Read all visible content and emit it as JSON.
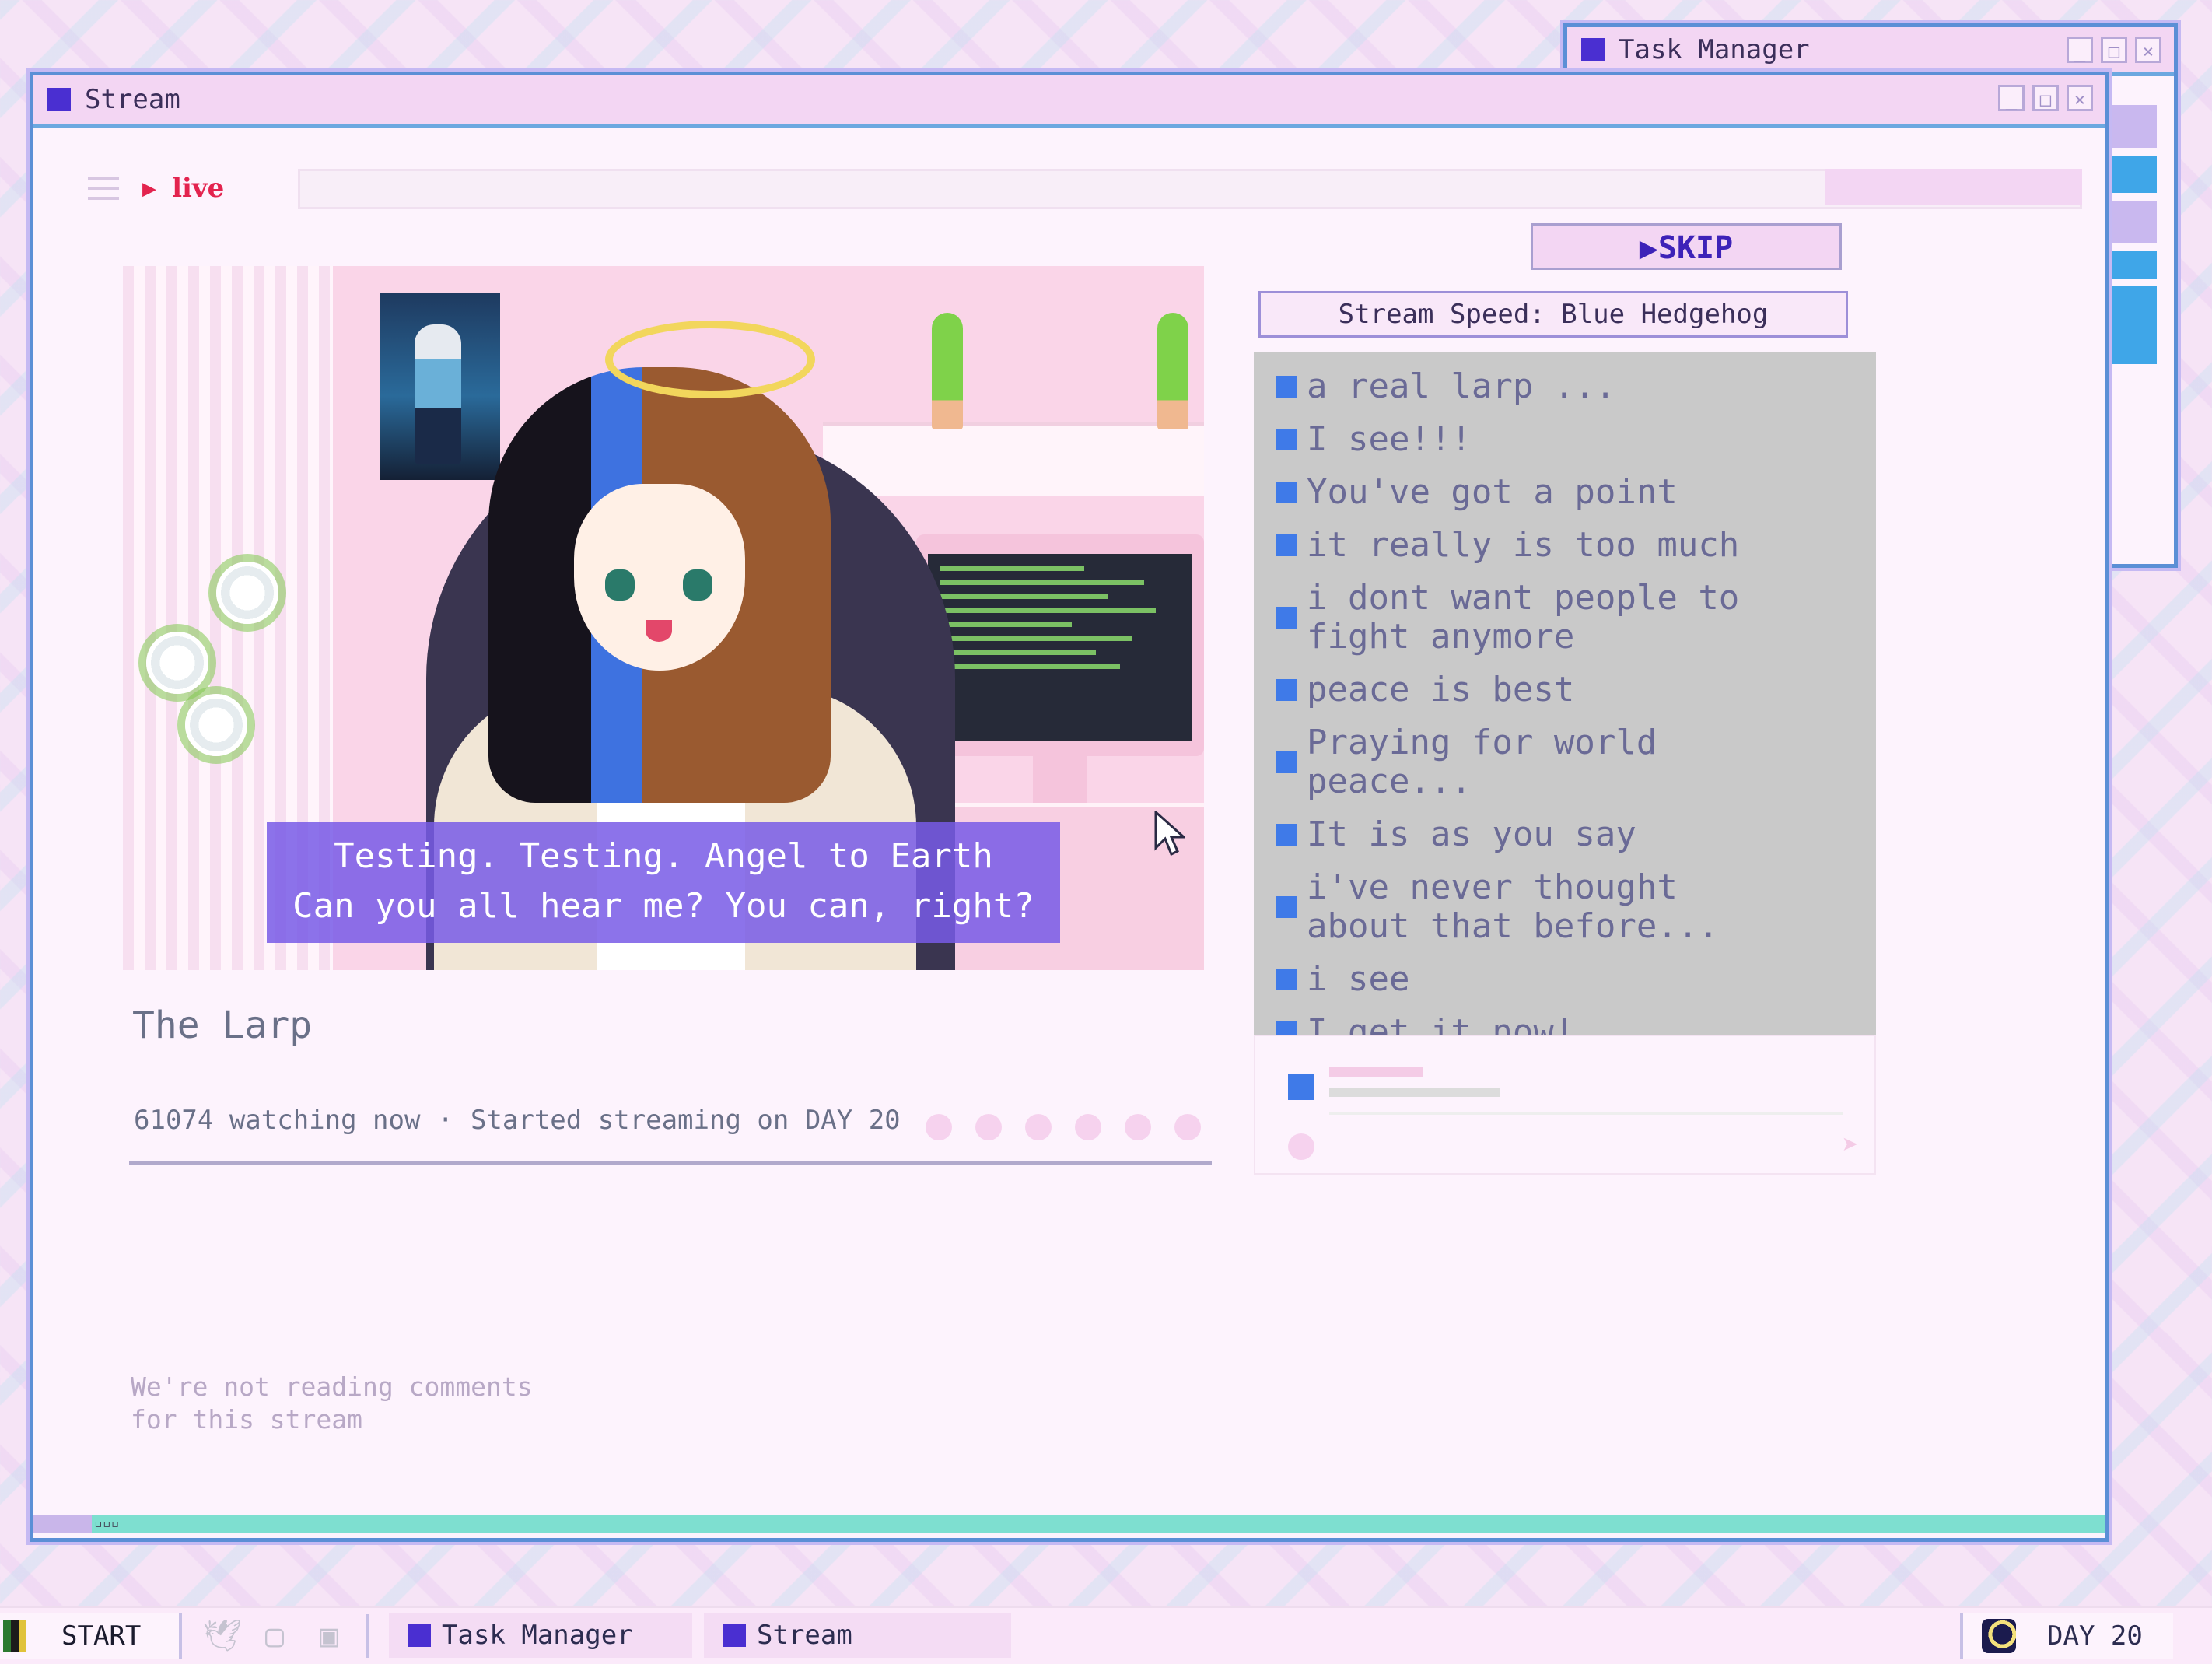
{
  "task_manager_window": {
    "title": "Task Manager"
  },
  "stream_window": {
    "title": "Stream",
    "live_label": "live",
    "video": {
      "subtitle_line1": "Testing. Testing. Angel to Earth",
      "subtitle_line2": "Can you all hear me? You can, right?"
    },
    "stream_title": "The Larp",
    "watching": "61074 watching now",
    "separator": "·",
    "started": "Started streaming on DAY 20",
    "no_comments_line1": "We're not reading comments",
    "no_comments_line2": "for this stream",
    "skip_label": "▶SKIP",
    "speed_label": "Stream Speed: Blue Hedgehog",
    "chat": [
      "a real larp ...",
      "I see!!!",
      "You've got a point",
      "it really is too much",
      "i dont want people to\nfight anymore",
      "peace is best",
      "Praying for world\npeace...",
      "It is as you say",
      "i've never thought\nabout that before...",
      "i see",
      "I get it now!"
    ],
    "status_glyph": "▫▫▫"
  },
  "taskbar": {
    "start_label": "START",
    "tasks": [
      "Task Manager",
      "Stream"
    ],
    "day_label": "DAY 20"
  },
  "icons": {
    "twitter": "twitter-icon",
    "chat": "chat-icon",
    "computer": "computer-icon",
    "moon": "moon-icon"
  },
  "colors": {
    "accent_purple": "#4a2fd1",
    "chat_square_blue": "#3f7ae8",
    "live_red": "#e3234e",
    "subtitle_bg": "#7a5ae6",
    "chat_panel_gray": "#c9c9c9",
    "window_border_teal": "#7edfd0"
  }
}
